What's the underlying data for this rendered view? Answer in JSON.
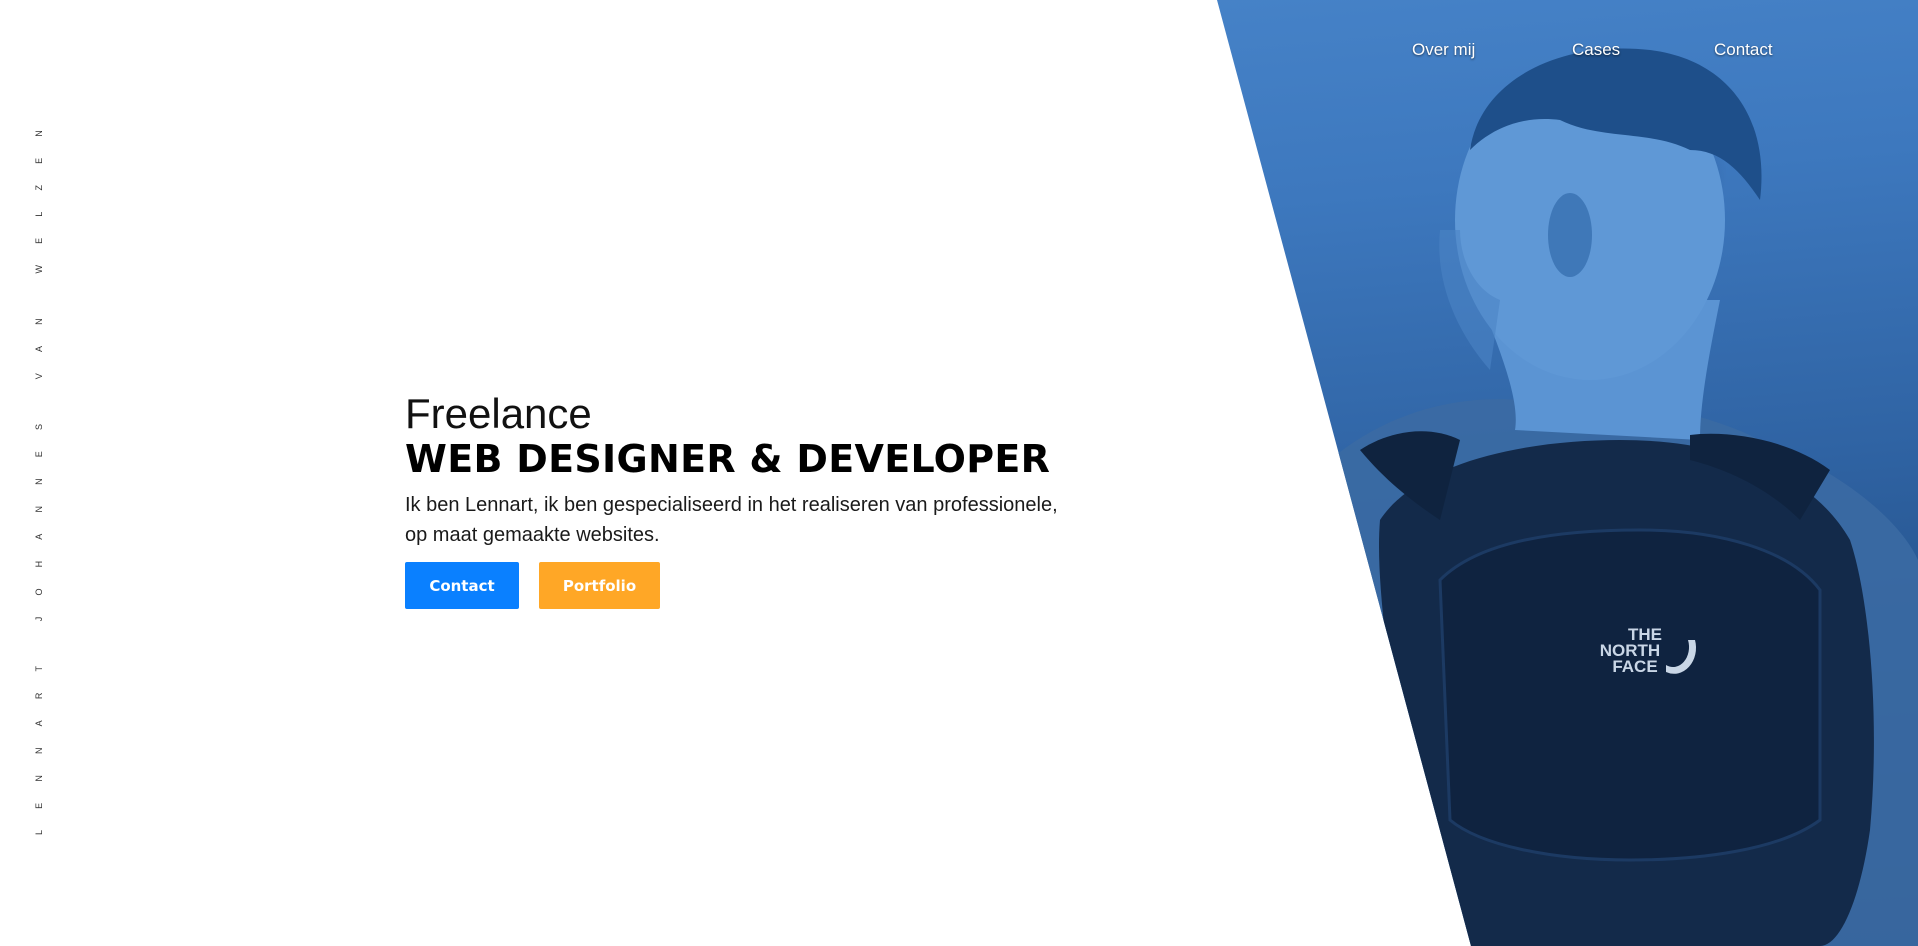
{
  "nav": {
    "items": [
      {
        "label": "Over mij"
      },
      {
        "label": "Cases"
      },
      {
        "label": "Contact"
      }
    ]
  },
  "side_name": {
    "text": "LENNART JOHANNES VAN WELZEN"
  },
  "hero": {
    "subtitle": "Freelance",
    "title": "WEB DESIGNER & DEVELOPER",
    "description": "Ik ben Lennart, ik ben gespecialiseerd in het realiseren van professionele, op maat gemaakte websites.",
    "buttons": {
      "contact_label": "Contact",
      "portfolio_label": "Portfolio"
    }
  },
  "photo": {
    "logo_text": "THE NORTH FACE"
  },
  "colors": {
    "accent_blue": "#0a80ff",
    "accent_orange": "#ffa726",
    "photo_tint": "#3d78be"
  }
}
